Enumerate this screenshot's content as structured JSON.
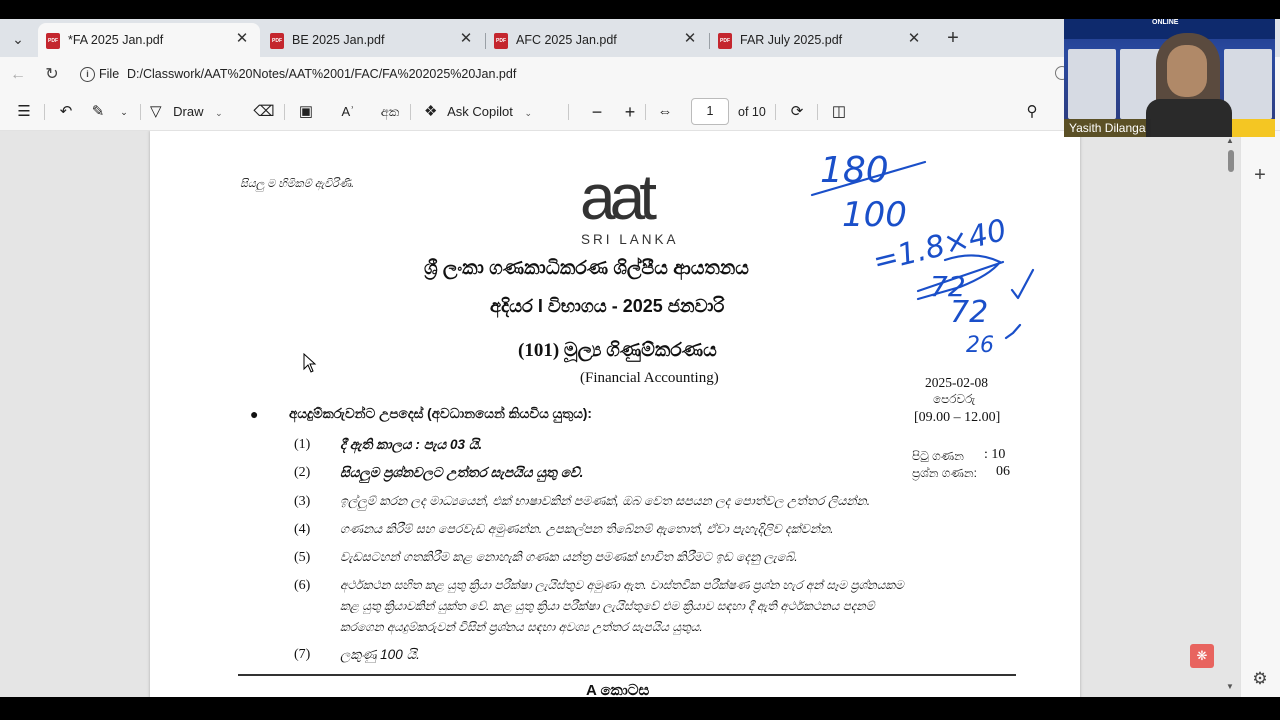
{
  "tabs": [
    {
      "label": "*FA 2025 Jan.pdf",
      "active": true
    },
    {
      "label": "BE 2025 Jan.pdf",
      "active": false
    },
    {
      "label": "AFC 2025 Jan.pdf",
      "active": false
    },
    {
      "label": "FAR July 2025.pdf",
      "active": false
    }
  ],
  "address": {
    "prefix": "File",
    "url": "D:/Classwork/AAT%20Notes/AAT%2001/FAC/FA%202025%20Jan.pdf"
  },
  "toolbar": {
    "draw_label": "Draw",
    "copilot_label": "Ask Copilot",
    "page_number": "1",
    "page_of": "of 10",
    "read_aloud_glyph": "Aʾ",
    "translate_glyph": "අක"
  },
  "document": {
    "blessing": "සියලු ම හිමිකම් ඇවිරිණි.",
    "logo_main": "aat",
    "logo_sub": "SRI LANKA",
    "institute": "ශ්‍රී ලංකා ගණකාධිකරණ ශිල්පීය ආයතනය",
    "exam": "අදියර I විභාගය - 2025 ජනවාරි",
    "subject": "(101) මූල්‍ය ගිණුම්කරණය",
    "subject_en": "(Financial Accounting)",
    "date": "2025-02-08",
    "session": "පෙරවරු",
    "time": "[09.00 – 12.00]",
    "pages_label": "පිටු ගණන",
    "pages_value": ":   10",
    "questions_label": "ප්‍රශ්න ගණන:",
    "questions_value": "06",
    "instructions_heading": "අයදුම්කරුවන්ට උපදෙස් (අවධානයෙන් කියවිය යුතුය):",
    "instructions": [
      {
        "num": "(1)",
        "text": "දී ඇති කාලය : පැය 03 යි."
      },
      {
        "num": "(2)",
        "text": "සියලුම ප්‍රශ්නවලට උත්තර සැපයිය යුතු වේ."
      },
      {
        "num": "(3)",
        "text": "ඉල්ලුම් කරන ලද මාධ්‍යයෙන්,  එක් භාෂාවකින් පමණක්,  ඔබ වෙත සපයන ලද පොත්වල උත්තර ලියන්න."
      },
      {
        "num": "(4)",
        "text": "ගණනය කිරීම් සහ පෙරවැඩ අමුණන්න. උපකල්පන තිබේනම් ඇතොත්, ඒවා පැහැදිලිව දක්වන්න."
      },
      {
        "num": "(5)",
        "text": "වැඩසටහන් ගතකිරීම කළ නොහැකි ගණක යන්ත්‍ර පමණක් භාවිත කිරීමට ඉඩ දෙනු ලැබේ."
      },
      {
        "num": "(6)",
        "text": "අර්ථකථන සහිත කළ යුතු ක්‍රියා පරීක්ෂා ලැයිස්තුව අමුණා ඇත. වාස්තවික පරීක්ෂණ ප්‍රශ්න හැර අන් සෑම ප්‍රශ්නයකම",
        "text2": "කළ යුතු ක්‍රියාවකින් යුක්ත වේ. කළ යුතු ක්‍රියා පරීක්ෂා ලැයිස්තුවේ එම ක්‍රියාව සඳහා දී ඇති අර්ථකථනය පදනම්",
        "text3": "කරගෙන අයදුම්කරුවන් විසින් ප්‍රශ්නය සඳහා අවශ්‍ය උත්තර සැපයිය යුතුය."
      },
      {
        "num": "(7)",
        "text": "ලකුණු 100 යි."
      }
    ],
    "section": "A  කොටස"
  },
  "webcam": {
    "name": "Yasith Dilanga",
    "banner_text": "ONLINE"
  },
  "annotations": {
    "line1": "180",
    "line2": "100",
    "line3": "=1.8×40",
    "line4": "72",
    "line5": "72",
    "line6": "26"
  }
}
